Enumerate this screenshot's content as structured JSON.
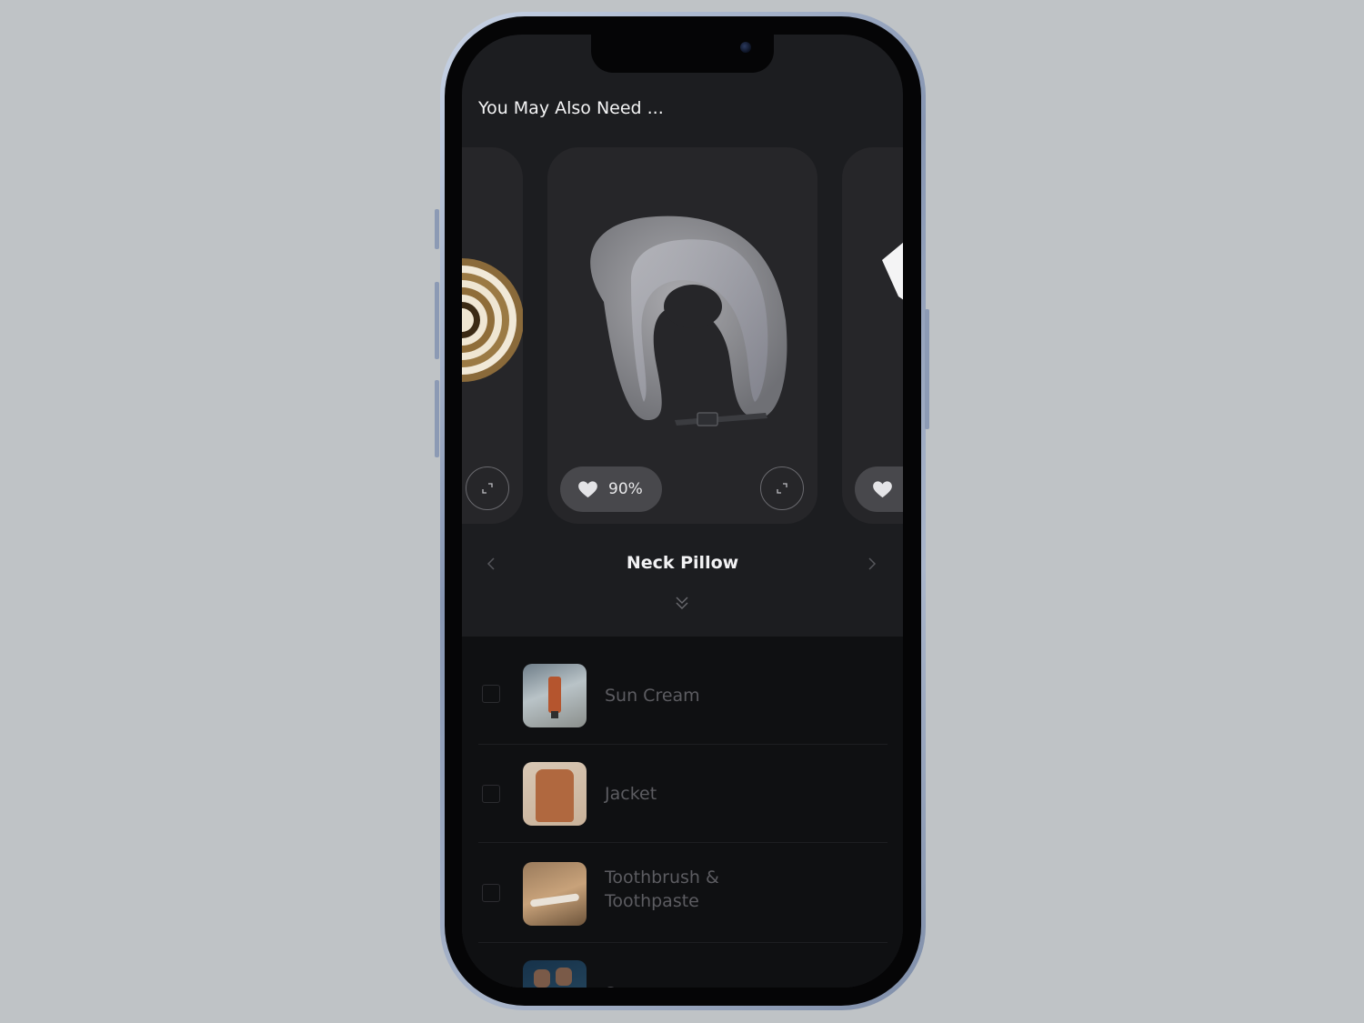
{
  "section_title": "You May Also Need ...",
  "carousel": {
    "current_item": {
      "name": "Neck Pillow",
      "like_percent": "90%",
      "image": "neck-pillow"
    },
    "previous_item": {
      "image": "straw-hat"
    },
    "next_item": {
      "image": "white-item"
    }
  },
  "checklist": {
    "items": [
      {
        "label": "Sun Cream",
        "checked": false,
        "thumb": "sun-cream"
      },
      {
        "label": "Jacket",
        "checked": false,
        "thumb": "jacket"
      },
      {
        "label": "Toothbrush &",
        "label_line2": "Toothpaste",
        "checked": false,
        "thumb": "toothbrush"
      },
      {
        "label": "S",
        "checked": false,
        "thumb": "shoes"
      }
    ]
  },
  "colors": {
    "screen_bg": "#1c1d20",
    "card_bg": "#262629",
    "list_bg": "#0f1012",
    "pill_bg": "#48484c"
  }
}
